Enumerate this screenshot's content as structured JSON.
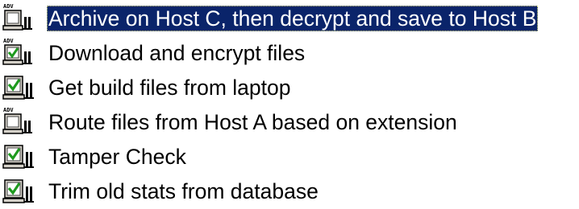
{
  "job_list": {
    "items": [
      {
        "label": "Archive on Host C, then decrypt and save to Host B",
        "icon": "advanced-job-icon",
        "badge": "ADV",
        "selected": true
      },
      {
        "label": "Download and encrypt files",
        "icon": "advanced-job-checked-icon",
        "badge": "ADV",
        "selected": false
      },
      {
        "label": "Get build files from laptop",
        "icon": "job-checked-icon",
        "selected": false
      },
      {
        "label": "Route files from Host A based on extension",
        "icon": "advanced-job-icon",
        "badge": "ADV",
        "selected": false
      },
      {
        "label": "Tamper Check",
        "icon": "job-checked-icon",
        "selected": false
      },
      {
        "label": "Trim old stats from database",
        "icon": "job-checked-icon",
        "selected": false
      }
    ]
  },
  "colors": {
    "selection_bg": "#0a246a",
    "selection_fg": "#ffffff",
    "check_green": "#1e9a1e"
  }
}
